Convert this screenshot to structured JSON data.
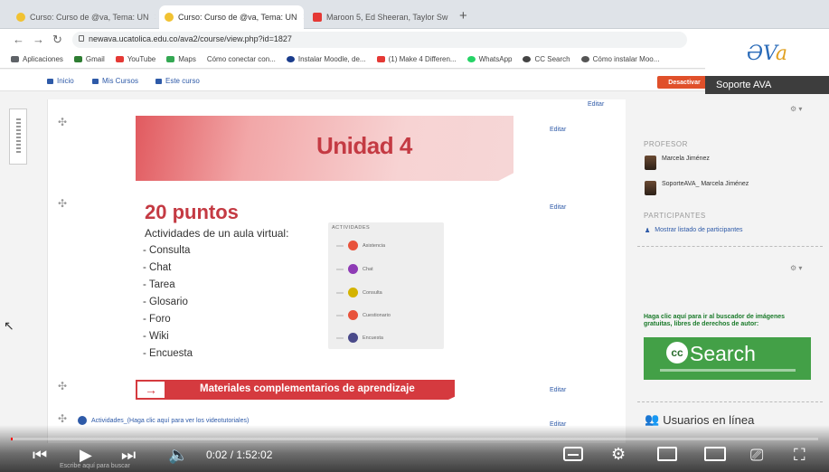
{
  "browser": {
    "tabs": [
      {
        "label": "Curso: Curso de @va, Tema: UN",
        "active": false,
        "icon_color": "#f1c232"
      },
      {
        "label": "Curso: Curso de @va, Tema: UN",
        "active": true,
        "icon_color": "#f1c232"
      },
      {
        "label": "Maroon 5, Ed Sheeran, Taylor Sw",
        "active": false,
        "icon_color": "#e53935"
      }
    ],
    "address": "newava.ucatolica.edu.co/ava2/course/view.php?id=1827",
    "bookmarks": [
      "Aplicaciones",
      "Gmail",
      "YouTube",
      "Maps",
      "Cómo conectar con...",
      "Instalar Moodle, de...",
      "(1) Make 4 Differen...",
      "WhatsApp",
      "CC Search",
      "Cómo instalar Moo..."
    ],
    "bookmark_colors": [
      "#5f6368",
      "#2e7d32",
      "#e53935",
      "#34a853",
      "#888888",
      "#1a3c8c",
      "#e53935",
      "#25d366",
      "#444444",
      "#555555"
    ]
  },
  "moodle": {
    "nav": [
      "Inicio",
      "Mis Cursos",
      "Este curso"
    ],
    "desactivar": "Desactivar",
    "soporte": "Soporte AVA",
    "editar_label": "Editar",
    "unidad_title": "Unidad 4",
    "puntos_title": "20 puntos",
    "actividades_subtitle": "Actividades de un aula virtual:",
    "actividades_list": [
      "- Consulta",
      "- Chat",
      "- Tarea",
      "- Glosario",
      "- Foro",
      "- Wiki",
      "- Encuesta"
    ],
    "panel_header": "ACTIVIDADES",
    "panel_items": [
      {
        "label": "Asistencia",
        "color": "#e8523b"
      },
      {
        "label": "Chat",
        "color": "#8e3bb5"
      },
      {
        "label": "Consulta",
        "color": "#d4b300"
      },
      {
        "label": "Cuestionario",
        "color": "#e8523b"
      },
      {
        "label": "Encuesta",
        "color": "#4a4a8a"
      }
    ],
    "materiales_title": "Materiales complementarios de aprendizaje",
    "videos_link": "Actividades_(Haga clic aquí para ver los videotutoriales)"
  },
  "sidebar": {
    "profesor_header": "PROFESOR",
    "profesores": [
      "Marcela Jiménez",
      "SoporteAVA_ Marcela Jiménez"
    ],
    "participantes_header": "PARTICIPANTES",
    "participantes_link": "Mostrar listado de participantes",
    "cc_text": "Haga clic aquí para ir al buscador de imágenes gratuitas, libres de derechos de autor:",
    "cc_logo": "cc",
    "cc_search": "Search",
    "usuarios_linea": "Usuarios en línea"
  },
  "logo": {
    "text_a": "ƏV",
    "text_b": "a"
  },
  "player": {
    "time": "0:02 / 1:52:02",
    "progress": 0.0003,
    "accent": "#ff0000"
  },
  "taskbar": {
    "search_text": "Escribe aquí para buscar"
  }
}
